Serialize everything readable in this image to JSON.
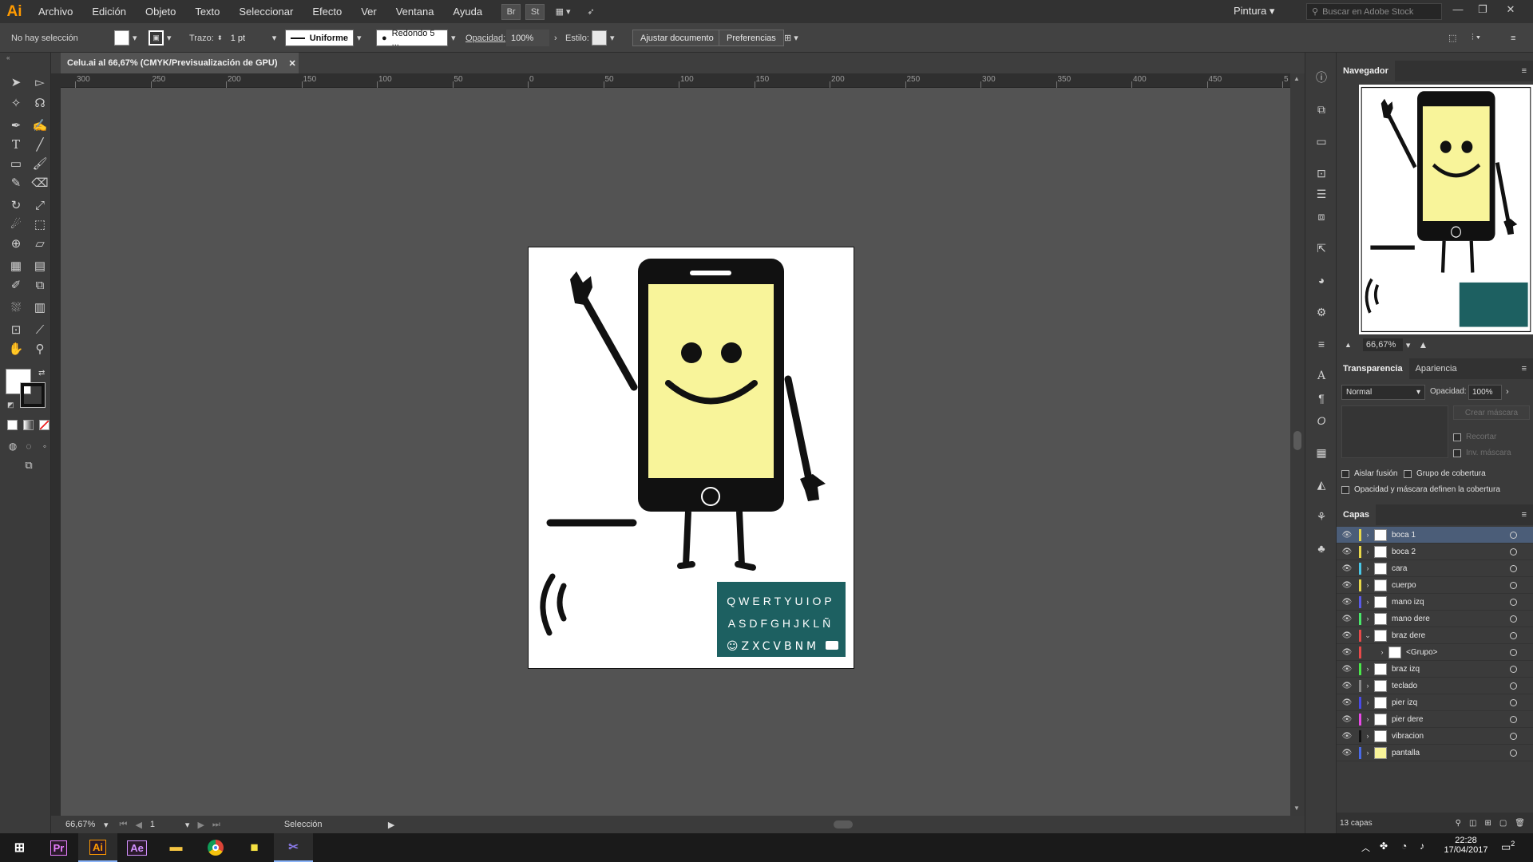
{
  "app": {
    "logo": "Ai",
    "workspace": "Pintura",
    "stock_search_placeholder": "Buscar en Adobe Stock"
  },
  "menu": [
    "Archivo",
    "Edición",
    "Objeto",
    "Texto",
    "Seleccionar",
    "Efecto",
    "Ver",
    "Ventana",
    "Ayuda"
  ],
  "menubar_buttons": [
    "Br",
    "St"
  ],
  "control": {
    "selection": "No hay selección",
    "stroke_label": "Trazo:",
    "stroke_value": "1 pt",
    "profile": "Uniforme",
    "brush": "Redondo 5 ...",
    "opacity_label": "Opacidad:",
    "opacity_value": "100%",
    "style_label": "Estilo:",
    "fit_button": "Ajustar documento",
    "prefs_button": "Preferencias"
  },
  "document": {
    "tab_title": "Celu.ai al 66,67% (CMYK/Previsualización de GPU)"
  },
  "ruler_labels": [
    "300",
    "250",
    "200",
    "150",
    "100",
    "50",
    "0",
    "50",
    "100",
    "150",
    "200",
    "250",
    "300",
    "350",
    "400",
    "450",
    "5"
  ],
  "status": {
    "zoom": "66,67%",
    "page": "1",
    "tool": "Selección"
  },
  "keyboard_rows": [
    "QWERTYUIOP",
    "ASDFGHJKLÑ",
    "☺ZXCVBNM"
  ],
  "navigator": {
    "title": "Navegador",
    "zoom": "66,67%"
  },
  "transparency": {
    "tabs": [
      "Transparencia",
      "Apariencia"
    ],
    "blend_mode": "Normal",
    "opacity_label": "Opacidad:",
    "opacity_value": "100%",
    "make_mask": "Crear máscara",
    "clip": "Recortar",
    "invert": "Inv. máscara",
    "isolate": "Aislar fusión",
    "knockout": "Grupo de cobertura",
    "opacity_mask": "Opacidad y máscara definen la cobertura"
  },
  "layers": {
    "title": "Capas",
    "count": "13 capas",
    "items": [
      {
        "name": "boca 1",
        "color": "#e8d84a",
        "selected": true,
        "expanded": false,
        "indent": false
      },
      {
        "name": "boca 2",
        "color": "#e8d84a",
        "selected": false,
        "expanded": false,
        "indent": false
      },
      {
        "name": "cara",
        "color": "#4ac8e8",
        "selected": false,
        "expanded": false,
        "indent": false
      },
      {
        "name": "cuerpo",
        "color": "#e8d84a",
        "selected": false,
        "expanded": false,
        "indent": false
      },
      {
        "name": "mano izq",
        "color": "#5a5ae8",
        "selected": false,
        "expanded": false,
        "indent": false
      },
      {
        "name": "mano dere",
        "color": "#4ae86a",
        "selected": false,
        "expanded": false,
        "indent": false
      },
      {
        "name": "braz dere",
        "color": "#e84a4a",
        "selected": false,
        "expanded": true,
        "indent": false
      },
      {
        "name": "<Grupo>",
        "color": "#e84a4a",
        "selected": false,
        "expanded": false,
        "indent": true
      },
      {
        "name": "braz izq",
        "color": "#4ae84a",
        "selected": false,
        "expanded": false,
        "indent": false
      },
      {
        "name": "teclado",
        "color": "#8a8a8a",
        "selected": false,
        "expanded": false,
        "indent": false
      },
      {
        "name": "pier izq",
        "color": "#4a4ae8",
        "selected": false,
        "expanded": false,
        "indent": false
      },
      {
        "name": "pier dere",
        "color": "#e84ae8",
        "selected": false,
        "expanded": false,
        "indent": false
      },
      {
        "name": "vibracion",
        "color": "#111111",
        "selected": false,
        "expanded": false,
        "indent": false
      },
      {
        "name": "pantalla",
        "color": "#4a6ae8",
        "selected": false,
        "expanded": false,
        "indent": false
      }
    ]
  },
  "taskbar": {
    "apps": [
      {
        "label": "Pr",
        "color": "#e77eff"
      },
      {
        "label": "Ai",
        "color": "#ff9a00"
      },
      {
        "label": "Ae",
        "color": "#d291ff"
      }
    ],
    "time": "22:28",
    "date": "17/04/2017",
    "notifications": "2"
  },
  "colors": {
    "screen": "#f8f49a",
    "keyboard": "#1d6061",
    "accent_select": "#4b5d78"
  }
}
